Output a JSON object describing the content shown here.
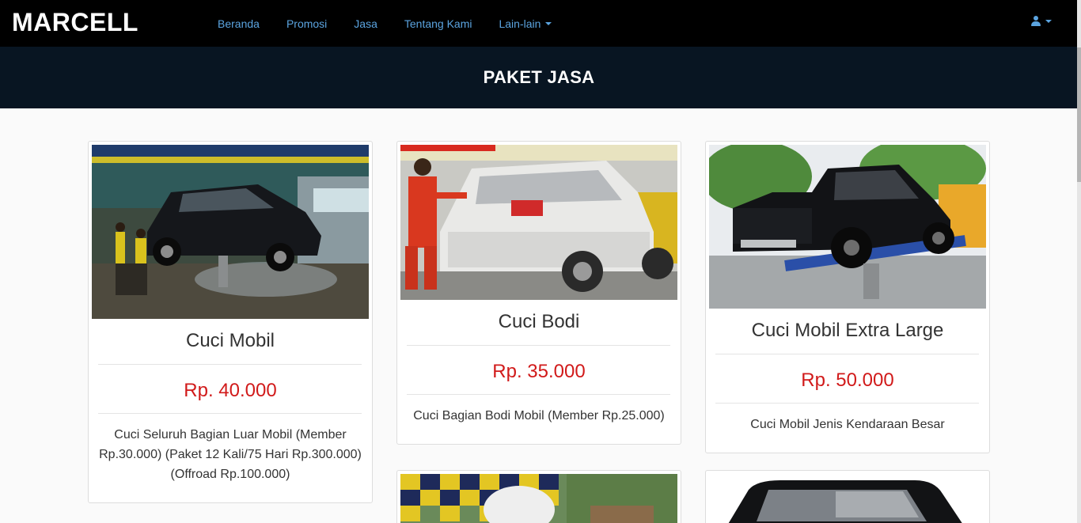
{
  "navbar": {
    "brand": "MARCELL",
    "links": [
      "Beranda",
      "Promosi",
      "Jasa",
      "Tentang Kami"
    ],
    "dropdown_label": "Lain-lain",
    "user_icon": "user-icon"
  },
  "header": {
    "title": "PAKET JASA"
  },
  "packages": [
    {
      "title": "Cuci Mobil",
      "price": "Rp. 40.000",
      "description": "Cuci Seluruh Bagian Luar Mobil (Member Rp.30.000) (Paket 12 Kali/75 Hari Rp.300.000) (Offroad Rp.100.000)",
      "image": "black SUV on lift in wash bay"
    },
    {
      "title": "Cuci Bodi",
      "price": "Rp. 35.000",
      "description": "Cuci Bagian Bodi Mobil (Member Rp.25.000)",
      "image": "foam-covered SUV washed by worker"
    },
    {
      "title": "Cuci Mobil Extra Large",
      "price": "Rp. 50.000",
      "description": "Cuci Mobil Jenis Kendaraan Besar",
      "image": "black pickup truck on lift"
    }
  ],
  "colors": {
    "navbar_bg": "#000000",
    "nav_link": "#5ba4e0",
    "band_bg": "#081522",
    "price": "#d11a1a"
  }
}
